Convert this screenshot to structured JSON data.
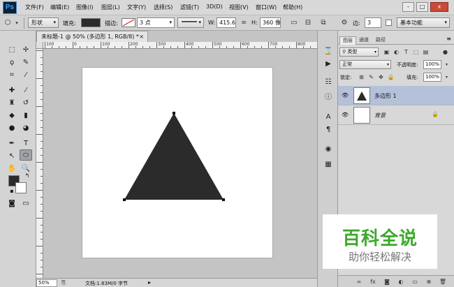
{
  "app": {
    "logo": "Ps",
    "menu": [
      "文件(F)",
      "编辑(E)",
      "图像(I)",
      "图层(L)",
      "文字(Y)",
      "选择(S)",
      "滤镜(T)",
      "3D(D)",
      "视图(V)",
      "窗口(W)",
      "帮助(H)"
    ],
    "window_controls": [
      "-",
      "□",
      "x"
    ]
  },
  "options": {
    "mode": "形状",
    "fill_label": "填充:",
    "stroke_label": "描边:",
    "stroke_width": "3 点",
    "w_label": "W:",
    "w_value": "415.69",
    "h_label": "H:",
    "h_value": "360 像",
    "sides_label": "边:",
    "sides_value": "3",
    "workspace": "基本功能",
    "fill_color": "#2b2b2b"
  },
  "document": {
    "tab_title": "未标题-1 @ 50% (多边形 1, RGB/8) *",
    "tab_close": "×",
    "ruler_labels": [
      "100",
      "0",
      "100",
      "200",
      "300",
      "400",
      "500",
      "600",
      "700",
      "800",
      "900"
    ],
    "shape_color": "#2b2b2b"
  },
  "status": {
    "zoom": "50%",
    "doc_info": "文档:1.83M/0 字节"
  },
  "layers_panel": {
    "tabs": [
      "图层",
      "通道",
      "路径"
    ],
    "kind_filter": "类型",
    "blend_mode": "正常",
    "opacity_label": "不透明度:",
    "opacity_value": "100%",
    "lock_label": "锁定:",
    "fill_label": "填充:",
    "fill_value": "100%",
    "layers": [
      {
        "name": "多边形 1",
        "selected": true
      },
      {
        "name": "背景",
        "selected": false
      }
    ],
    "bottom_icons": [
      "link-icon",
      "fx-icon",
      "mask-icon",
      "adjustment-icon",
      "group-icon",
      "new-layer-icon",
      "trash-icon"
    ]
  },
  "watermark": {
    "title": "百科全说",
    "subtitle": "助你轻松解决"
  }
}
